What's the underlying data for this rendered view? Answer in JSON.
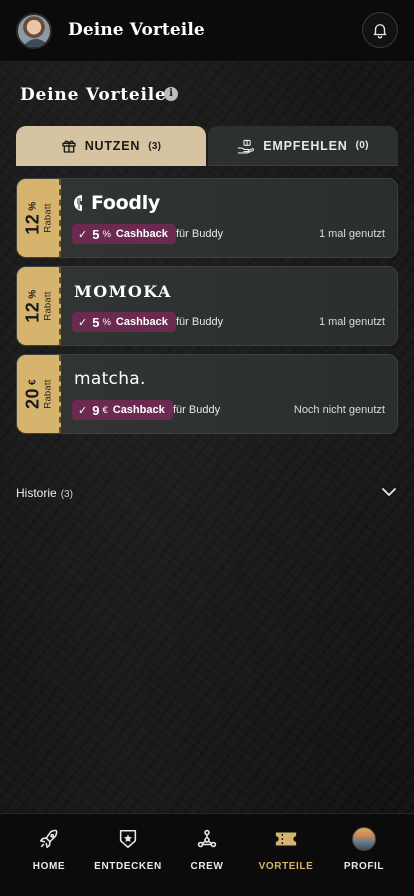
{
  "header": {
    "title": "Deine Vorteile",
    "avatar_icon": "user-avatar",
    "bell_icon": "bell-icon"
  },
  "page": {
    "title": "Deine Vorteile",
    "info_glyph": "i"
  },
  "tabs": [
    {
      "label": "NUTZEN",
      "count": "(3)",
      "icon": "gift-icon",
      "active": true
    },
    {
      "label": "EMPFEHLEN",
      "count": "(0)",
      "icon": "hand-gift-icon",
      "active": false
    }
  ],
  "offers": [
    {
      "discount": "12",
      "discount_unit": "%",
      "discount_label": "Rabatt",
      "brand": "Foodly",
      "cashback_value": "5",
      "cashback_unit": "%",
      "cashback_label": "Cashback",
      "for_label": "für Buddy",
      "usage": "1 mal genutzt"
    },
    {
      "discount": "12",
      "discount_unit": "%",
      "discount_label": "Rabatt",
      "brand": "MOMOKA",
      "cashback_value": "5",
      "cashback_unit": "%",
      "cashback_label": "Cashback",
      "for_label": "für Buddy",
      "usage": "1 mal genutzt"
    },
    {
      "discount": "20",
      "discount_unit": "€",
      "discount_label": "Rabatt",
      "brand": "matcha.",
      "cashback_value": "9",
      "cashback_unit": "€",
      "cashback_label": "Cashback",
      "for_label": "für Buddy",
      "usage": "Noch nicht genutzt"
    }
  ],
  "history": {
    "label": "Historie",
    "count": "(3)"
  },
  "bottom_nav": [
    {
      "label": "HOME",
      "icon": "rocket-icon",
      "active": false
    },
    {
      "label": "ENTDECKEN",
      "icon": "star-shield-icon",
      "active": false
    },
    {
      "label": "CREW",
      "icon": "network-icon",
      "active": false
    },
    {
      "label": "VORTEILE",
      "icon": "ticket-icon",
      "active": true
    },
    {
      "label": "PROFIL",
      "icon": "profile-picture",
      "active": false
    }
  ],
  "colors": {
    "accent_gold": "#d7b46e",
    "tab_active_bg": "#d6c3a1",
    "cashback_badge": "#6b2a50",
    "background": "#141414"
  }
}
